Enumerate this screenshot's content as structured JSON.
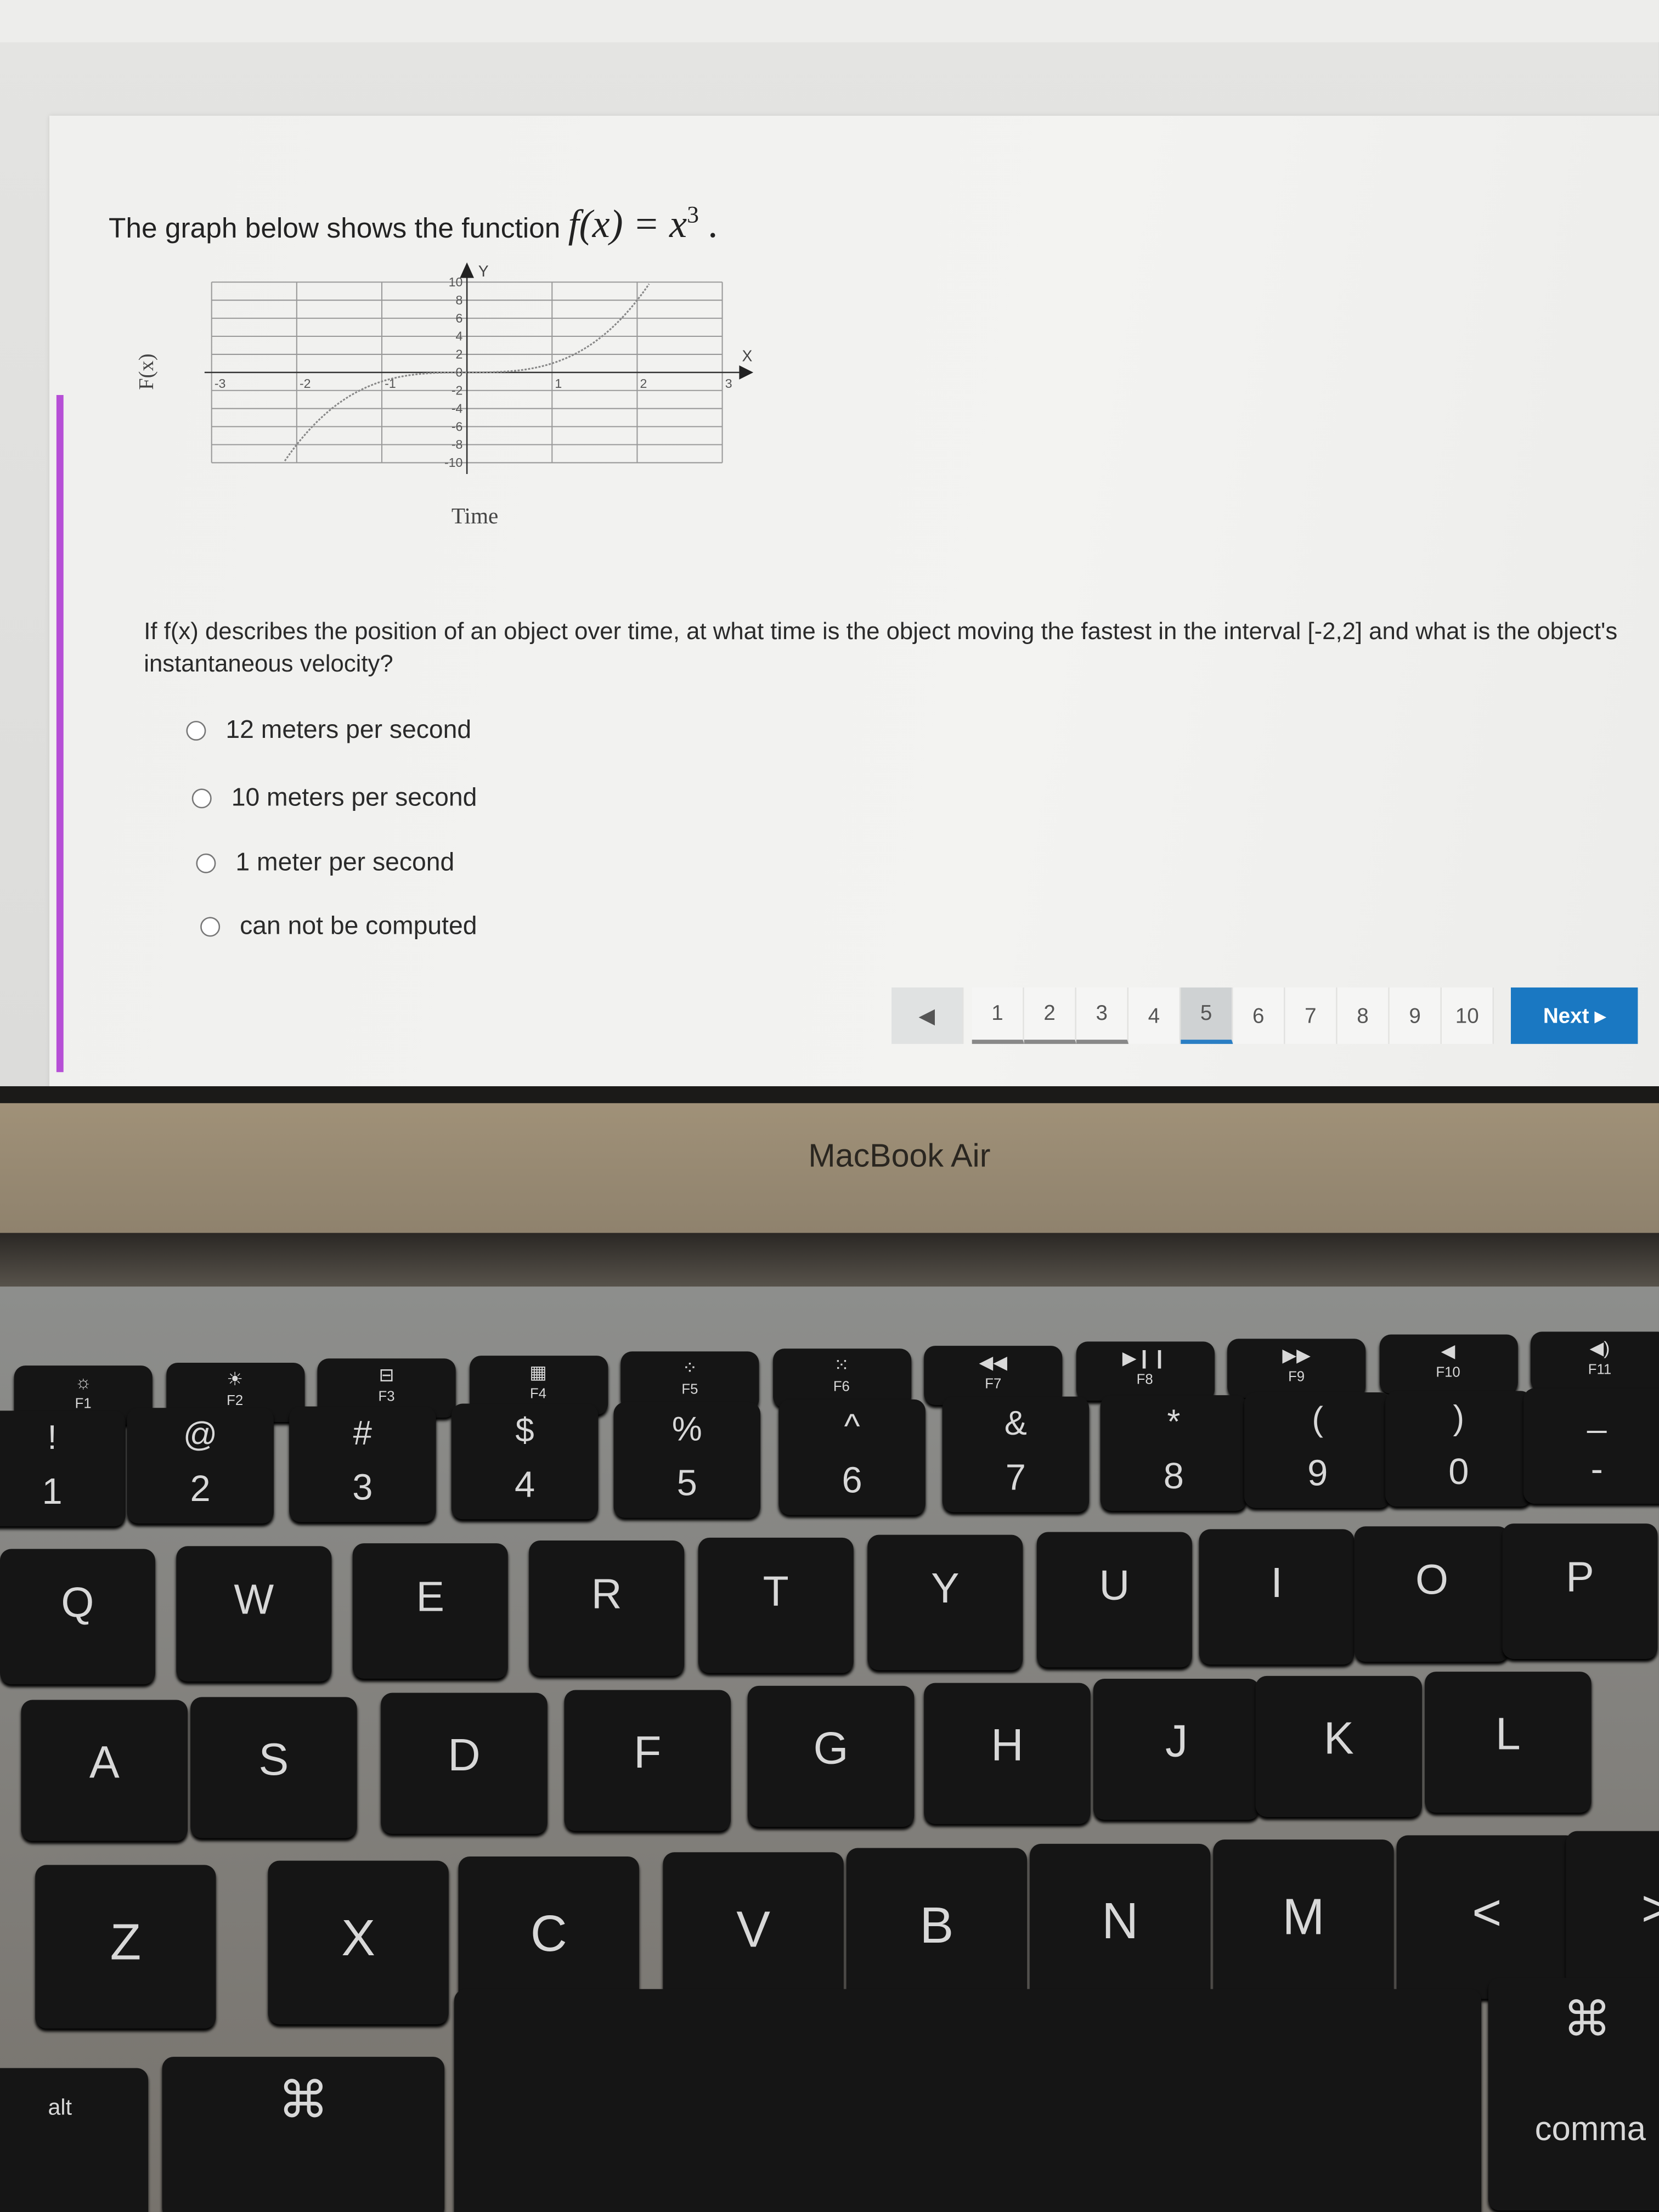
{
  "question": {
    "title_prefix": "The graph below shows the function",
    "function_lhs": "f(x) = x",
    "function_exp": "3",
    "function_end": ".",
    "body": "If f(x) describes the position of an object over time, at what time is the object moving the fastest in the interval [-2,2] and what is the object's instantaneous velocity?",
    "options": [
      {
        "label": "12 meters per second",
        "selected": false
      },
      {
        "label": "10 meters per second",
        "selected": false
      },
      {
        "label": "1 meter per second",
        "selected": false
      },
      {
        "label": "can not be computed",
        "selected": false
      }
    ]
  },
  "chart_data": {
    "type": "line",
    "function": "x^3",
    "xlabel": "Time",
    "ylabel": "F(x)",
    "x_axis_letter": "X",
    "y_axis_letter": "Y",
    "xlim": [
      -3,
      3
    ],
    "ylim": [
      -10,
      10
    ],
    "x_ticks": [
      "-3",
      "-2",
      "-1",
      "1",
      "2",
      "3"
    ],
    "y_ticks": [
      "10",
      "8",
      "6",
      "4",
      "2",
      "0",
      "-2",
      "-4",
      "-6",
      "-8",
      "-10"
    ],
    "grid": true,
    "line_style": "dotted",
    "line_color": "#888888"
  },
  "pagination": {
    "prev_icon": "triangle-left-icon",
    "pages": [
      "1",
      "2",
      "3",
      "4",
      "5",
      "6",
      "7",
      "8",
      "9",
      "10"
    ],
    "current": "5",
    "next_label": "Next ▸",
    "accent": "#1a78c2"
  },
  "laptop": {
    "brand": "MacBook Air"
  },
  "keyboard": {
    "fn_row": [
      {
        "icon": "☼",
        "label": "F1"
      },
      {
        "icon": "☀",
        "label": "F2"
      },
      {
        "icon": "⊟",
        "label": "F3"
      },
      {
        "icon": "▦",
        "label": "F4"
      },
      {
        "icon": "⁘",
        "label": "F5"
      },
      {
        "icon": "⁙",
        "label": "F6"
      },
      {
        "icon": "◀◀",
        "label": "F7"
      },
      {
        "icon": "▶❙❙",
        "label": "F8"
      },
      {
        "icon": "▶▶",
        "label": "F9"
      },
      {
        "icon": "◀",
        "label": "F10"
      },
      {
        "icon": "◀)",
        "label": "F11"
      }
    ],
    "num_row": [
      {
        "top": "!",
        "main": "1"
      },
      {
        "top": "@",
        "main": "2"
      },
      {
        "top": "#",
        "main": "3"
      },
      {
        "top": "$",
        "main": "4"
      },
      {
        "top": "%",
        "main": "5"
      },
      {
        "top": "^",
        "main": "6"
      },
      {
        "top": "&",
        "main": "7"
      },
      {
        "top": "*",
        "main": "8"
      },
      {
        "top": "(",
        "main": "9"
      },
      {
        "top": ")",
        "main": "0"
      },
      {
        "top": "_",
        "main": "-"
      }
    ],
    "row_q": [
      "Q",
      "W",
      "E",
      "R",
      "T",
      "Y",
      "U",
      "I",
      "O",
      "P"
    ],
    "row_a": [
      "A",
      "S",
      "D",
      "F",
      "G",
      "H",
      "J",
      "K",
      "L"
    ],
    "row_z": [
      "Z",
      "X",
      "C",
      "V",
      "B",
      "N",
      "M",
      "<",
      ">"
    ],
    "bottom": {
      "alt": "alt",
      "cmd_left": "⌘",
      "cmd_right": "⌘",
      "cmd_right_label": "comma"
    }
  }
}
